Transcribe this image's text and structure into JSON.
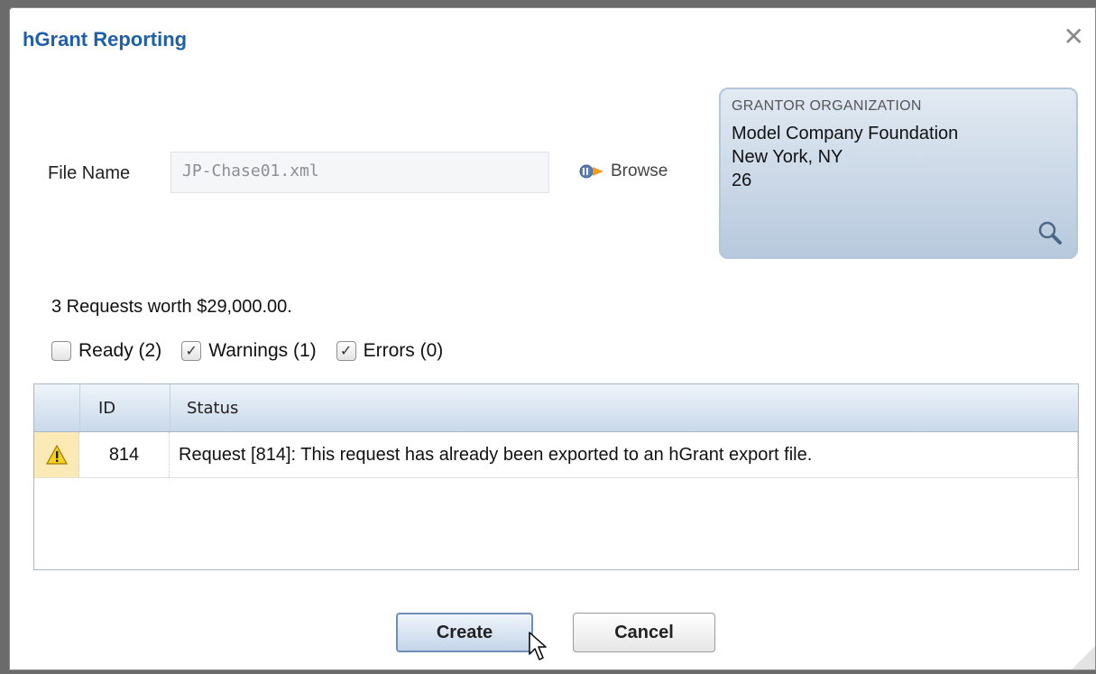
{
  "dialog": {
    "title": "hGrant Reporting",
    "close_glyph": "✕"
  },
  "file": {
    "label": "File Name",
    "value": "JP-Chase01.xml",
    "browse_label": "Browse",
    "browse_icon": "browse-arrow-icon"
  },
  "grantor": {
    "heading": "GRANTOR ORGANIZATION",
    "name": "Model Company Foundation",
    "location": "New York, NY",
    "id": "26",
    "search_icon": "magnifier-icon"
  },
  "summary": "3 Requests worth $29,000.00.",
  "filters": [
    {
      "label": "Ready (2)",
      "checked": false
    },
    {
      "label": "Warnings (1)",
      "checked": true
    },
    {
      "label": "Errors (0)",
      "checked": true
    }
  ],
  "grid": {
    "columns": [
      "",
      "ID",
      "Status"
    ],
    "rows": [
      {
        "icon": "warning-icon",
        "id": "814",
        "status": "Request [814]: This request has already been exported to an hGrant export file."
      }
    ]
  },
  "buttons": {
    "create": "Create",
    "cancel": "Cancel"
  },
  "colors": {
    "title": "#1f5fa8",
    "warning_bg": "#fbe9b6",
    "header_bg": "#c9d9ea"
  }
}
